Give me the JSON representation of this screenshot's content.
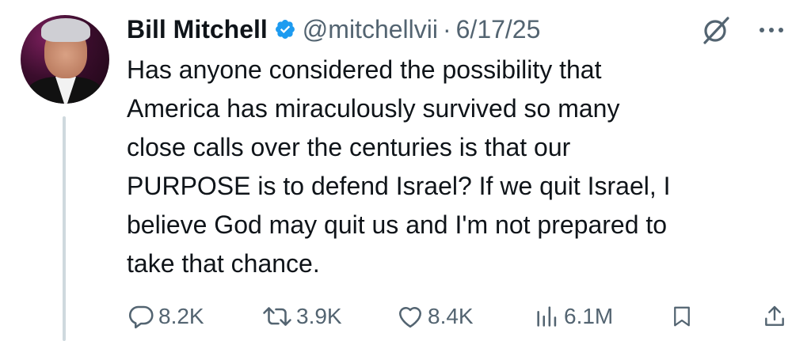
{
  "tweet": {
    "author": {
      "name": "Bill Mitchell",
      "handle": "@mitchellvii",
      "verified": true
    },
    "separator": "·",
    "date": "6/17/25",
    "text": "Has anyone considered the possibility that\nAmerica has miraculously survived so many\nclose calls over the centuries is that our\nPURPOSE is to defend Israel?  If we quit Israel, I\nbelieve God may quit us and I'm not prepared to\ntake that chance.",
    "metrics": {
      "replies": "8.2K",
      "reposts": "3.9K",
      "likes": "8.4K",
      "views": "6.1M"
    },
    "icons": {
      "verified": "verified-badge-icon",
      "grok": "grok-icon",
      "more": "more-icon",
      "reply": "reply-icon",
      "repost": "repost-icon",
      "like": "like-icon",
      "views": "views-icon",
      "bookmark": "bookmark-icon",
      "share": "share-icon"
    },
    "colors": {
      "text": "#0f1419",
      "secondary": "#536471",
      "verified": "#1d9bf0",
      "thread_line": "#cfd9de"
    }
  }
}
